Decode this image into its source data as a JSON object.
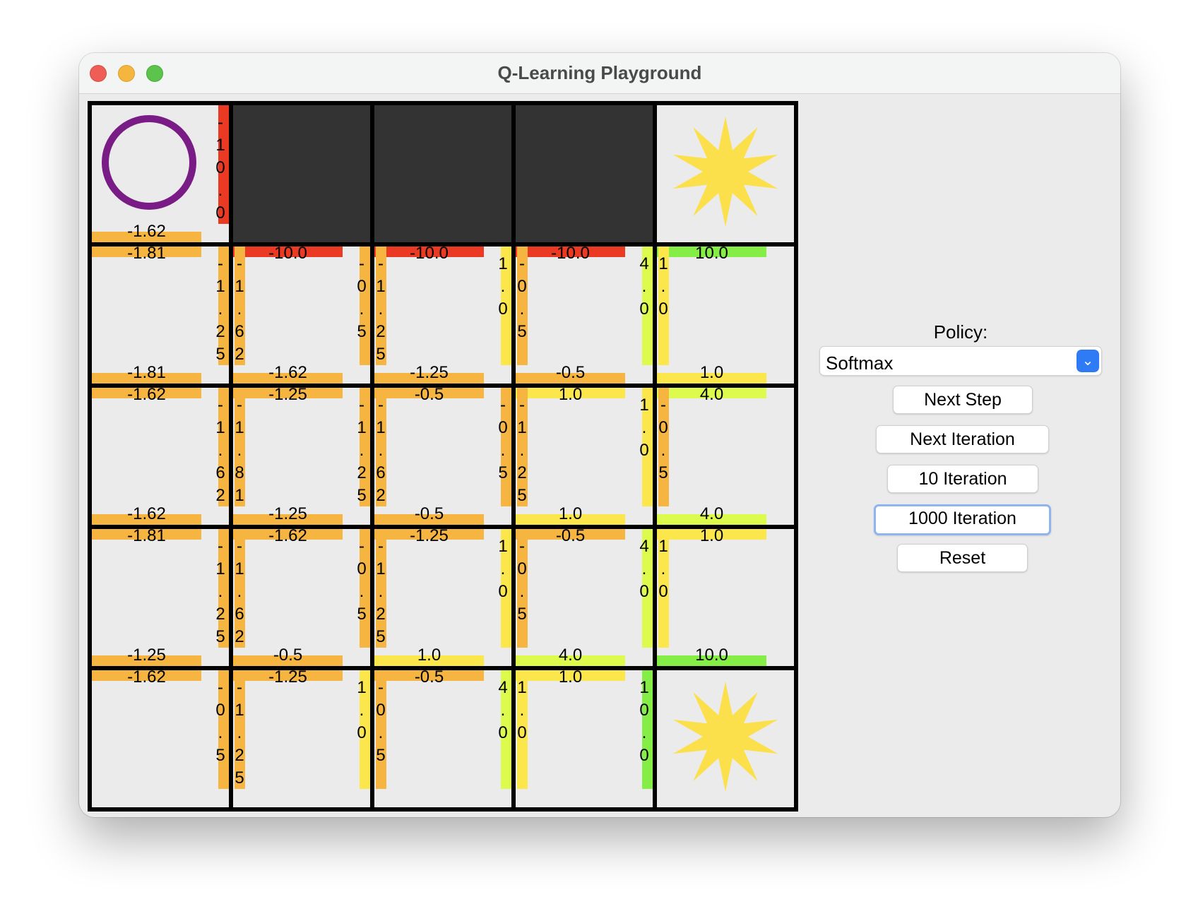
{
  "window": {
    "title": "Q-Learning Playground"
  },
  "colors": {
    "red": "#eb3a23",
    "orange": "#f6b441",
    "yellow": "#fbe64b",
    "lime": "#dcfb4d",
    "green": "#84ee46",
    "star": "#fbe04b",
    "agent": "#7a1c85",
    "wall": "#333333"
  },
  "grid": {
    "rows": 5,
    "cols": 5,
    "agent": {
      "row": 0,
      "col": 0,
      "icon": "ring-icon"
    },
    "walls": [
      [
        0,
        1
      ],
      [
        0,
        2
      ],
      [
        0,
        3
      ]
    ],
    "goals": [
      [
        0,
        4
      ],
      [
        4,
        4
      ]
    ],
    "q_values": [
      [
        {
          "up": null,
          "right": "-10.0",
          "down": "-1.62",
          "left": null
        },
        null,
        null,
        null,
        null
      ],
      [
        {
          "up": "-1.81",
          "right": "-1.25",
          "down": "-1.81",
          "left": null
        },
        {
          "up": "-10.0",
          "right": "-0.5",
          "down": "-1.62",
          "left": "-1.62"
        },
        {
          "up": "-10.0",
          "right": "1.0",
          "down": "-1.25",
          "left": "-1.25"
        },
        {
          "up": "-10.0",
          "right": "4.0",
          "down": "-0.5",
          "left": "-0.5"
        },
        {
          "up": "10.0",
          "right": null,
          "down": "1.0",
          "left": "1.0"
        }
      ],
      [
        {
          "up": "-1.62",
          "right": "-1.62",
          "down": "-1.62",
          "left": null
        },
        {
          "up": "-1.25",
          "right": "-1.25",
          "down": "-1.25",
          "left": "-1.81"
        },
        {
          "up": "-0.5",
          "right": "-0.5",
          "down": "-0.5",
          "left": "-1.62"
        },
        {
          "up": "1.0",
          "right": "1.0",
          "down": "1.0",
          "left": "-1.25"
        },
        {
          "up": "4.0",
          "right": null,
          "down": "4.0",
          "left": "-0.5"
        }
      ],
      [
        {
          "up": "-1.81",
          "right": "-1.25",
          "down": "-1.25",
          "left": null
        },
        {
          "up": "-1.62",
          "right": "-0.5",
          "down": "-0.5",
          "left": "-1.62"
        },
        {
          "up": "-1.25",
          "right": "1.0",
          "down": "1.0",
          "left": "-1.25"
        },
        {
          "up": "-0.5",
          "right": "4.0",
          "down": "4.0",
          "left": "-0.5"
        },
        {
          "up": "1.0",
          "right": null,
          "down": "10.0",
          "left": "1.0"
        }
      ],
      [
        {
          "up": "-1.62",
          "right": "-0.5",
          "down": null,
          "left": null
        },
        {
          "up": "-1.25",
          "right": "1.0",
          "down": null,
          "left": "-1.25"
        },
        {
          "up": "-0.5",
          "right": "4.0",
          "down": null,
          "left": "-0.5"
        },
        {
          "up": "1.0",
          "right": "10.0",
          "down": null,
          "left": "1.0"
        },
        null
      ]
    ]
  },
  "controls": {
    "policy_label": "Policy:",
    "policy_value": "Softmax",
    "buttons": {
      "next_step": "Next Step",
      "next_iteration": "Next Iteration",
      "ten_iteration": "10 Iteration",
      "thousand_iteration": "1000 Iteration",
      "reset": "Reset"
    }
  }
}
